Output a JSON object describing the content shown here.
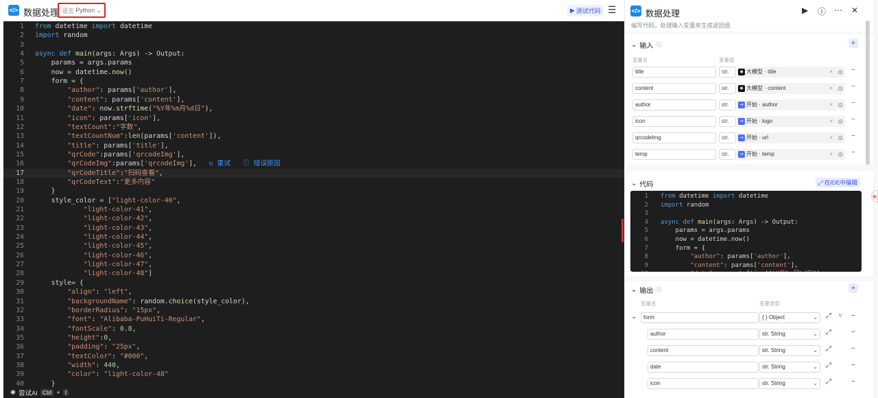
{
  "window": {
    "title": "数据处理",
    "language_label": "语言",
    "language": "Python",
    "test_button": "测试代码"
  },
  "editor": {
    "lines": [
      [
        {
          "t": "from",
          "c": "kw"
        },
        {
          "t": " datetime "
        },
        {
          "t": "import",
          "c": "kw"
        },
        {
          "t": " datetime"
        }
      ],
      [
        {
          "t": "import",
          "c": "kw"
        },
        {
          "t": " random"
        }
      ],
      [],
      [
        {
          "t": "async def",
          "c": "kw"
        },
        {
          "t": " "
        },
        {
          "t": "main",
          "c": "fn"
        },
        {
          "t": "(args: Args) -> Output:"
        }
      ],
      [
        {
          "t": "    params = args.params"
        }
      ],
      [
        {
          "t": "    now = datetime."
        },
        {
          "t": "now",
          "c": "fn"
        },
        {
          "t": "()"
        }
      ],
      [
        {
          "t": "    form = {"
        }
      ],
      [
        {
          "t": "        "
        },
        {
          "t": "\"author\"",
          "c": "str"
        },
        {
          "t": ": params["
        },
        {
          "t": "'author'",
          "c": "str"
        },
        {
          "t": "],"
        }
      ],
      [
        {
          "t": "        "
        },
        {
          "t": "\"content\"",
          "c": "str"
        },
        {
          "t": ": params["
        },
        {
          "t": "'content'",
          "c": "str"
        },
        {
          "t": "],"
        }
      ],
      [
        {
          "t": "        "
        },
        {
          "t": "\"date\"",
          "c": "str"
        },
        {
          "t": ": now."
        },
        {
          "t": "strftime",
          "c": "fn"
        },
        {
          "t": "("
        },
        {
          "t": "\"%Y年%m月%d日\"",
          "c": "str"
        },
        {
          "t": "),"
        }
      ],
      [
        {
          "t": "        "
        },
        {
          "t": "\"icon\"",
          "c": "str"
        },
        {
          "t": ": params["
        },
        {
          "t": "'icon'",
          "c": "str"
        },
        {
          "t": "],"
        }
      ],
      [
        {
          "t": "        "
        },
        {
          "t": "\"textCount\"",
          "c": "str"
        },
        {
          "t": ":"
        },
        {
          "t": "\"字数\"",
          "c": "str"
        },
        {
          "t": ","
        }
      ],
      [
        {
          "t": "        "
        },
        {
          "t": "\"textCountNum\"",
          "c": "str"
        },
        {
          "t": ":"
        },
        {
          "t": "len",
          "c": "fn"
        },
        {
          "t": "(params["
        },
        {
          "t": "'content'",
          "c": "str"
        },
        {
          "t": "]),"
        }
      ],
      [
        {
          "t": "        "
        },
        {
          "t": "\"title\"",
          "c": "str"
        },
        {
          "t": ": params["
        },
        {
          "t": "'title'",
          "c": "str"
        },
        {
          "t": "],"
        }
      ],
      [
        {
          "t": "        "
        },
        {
          "t": "\"qrCode\"",
          "c": "str"
        },
        {
          "t": ":params["
        },
        {
          "t": "'qrcodeImg'",
          "c": "str"
        },
        {
          "t": "],"
        }
      ],
      [
        {
          "t": "        "
        },
        {
          "t": "\"qrCodeImg\"",
          "c": "str"
        },
        {
          "t": ":params["
        },
        {
          "t": "'qrcodeImg'",
          "c": "str"
        },
        {
          "t": "],   "
        },
        {
          "t": "↻ 重试",
          "c": "lnk"
        },
        {
          "t": "   "
        },
        {
          "t": "ⓘ 错误原因",
          "c": "err"
        }
      ],
      [
        {
          "t": "        "
        },
        {
          "t": "\"qrCodeTitle\"",
          "c": "str"
        },
        {
          "t": ":"
        },
        {
          "t": "\"扫码查看\"",
          "c": "str"
        },
        {
          "t": ","
        }
      ],
      [
        {
          "t": "        "
        },
        {
          "t": "\"qrCodeText\"",
          "c": "str"
        },
        {
          "t": ":"
        },
        {
          "t": "\"更多内容\"",
          "c": "str"
        }
      ],
      [
        {
          "t": "    }"
        }
      ],
      [
        {
          "t": "    style_color = ["
        },
        {
          "t": "\"light-color-40\"",
          "c": "str"
        },
        {
          "t": ","
        }
      ],
      [
        {
          "t": "            "
        },
        {
          "t": "\"light-color-41\"",
          "c": "str"
        },
        {
          "t": ","
        }
      ],
      [
        {
          "t": "            "
        },
        {
          "t": "\"light-color-42\"",
          "c": "str"
        },
        {
          "t": ","
        }
      ],
      [
        {
          "t": "            "
        },
        {
          "t": "\"light-color-43\"",
          "c": "str"
        },
        {
          "t": ","
        }
      ],
      [
        {
          "t": "            "
        },
        {
          "t": "\"light-color-44\"",
          "c": "str"
        },
        {
          "t": ","
        }
      ],
      [
        {
          "t": "            "
        },
        {
          "t": "\"light-color-45\"",
          "c": "str"
        },
        {
          "t": ","
        }
      ],
      [
        {
          "t": "            "
        },
        {
          "t": "\"light-color-46\"",
          "c": "str"
        },
        {
          "t": ","
        }
      ],
      [
        {
          "t": "            "
        },
        {
          "t": "\"light-color-47\"",
          "c": "str"
        },
        {
          "t": ","
        }
      ],
      [
        {
          "t": "            "
        },
        {
          "t": "\"light-color-48\"",
          "c": "str"
        },
        {
          "t": "]"
        }
      ],
      [
        {
          "t": "    style= {"
        }
      ],
      [
        {
          "t": "        "
        },
        {
          "t": "\"align\"",
          "c": "str"
        },
        {
          "t": ": "
        },
        {
          "t": "\"left\"",
          "c": "str"
        },
        {
          "t": ","
        }
      ],
      [
        {
          "t": "        "
        },
        {
          "t": "\"backgroundName\"",
          "c": "str"
        },
        {
          "t": ": random."
        },
        {
          "t": "choice",
          "c": "fn"
        },
        {
          "t": "(style_color),"
        }
      ],
      [
        {
          "t": "        "
        },
        {
          "t": "\"borderRadius\"",
          "c": "str"
        },
        {
          "t": ": "
        },
        {
          "t": "\"15px\"",
          "c": "str"
        },
        {
          "t": ","
        }
      ],
      [
        {
          "t": "        "
        },
        {
          "t": "\"font\"",
          "c": "str"
        },
        {
          "t": ": "
        },
        {
          "t": "\"Alibaba-PuHuiTi-Regular\"",
          "c": "str"
        },
        {
          "t": ","
        }
      ],
      [
        {
          "t": "        "
        },
        {
          "t": "\"fontScale\"",
          "c": "str"
        },
        {
          "t": ": "
        },
        {
          "t": "0.8",
          "c": "num"
        },
        {
          "t": ","
        }
      ],
      [
        {
          "t": "        "
        },
        {
          "t": "\"height\"",
          "c": "str"
        },
        {
          "t": ":"
        },
        {
          "t": "0",
          "c": "num"
        },
        {
          "t": ","
        }
      ],
      [
        {
          "t": "        "
        },
        {
          "t": "\"padding\"",
          "c": "str"
        },
        {
          "t": ": "
        },
        {
          "t": "\"25px\"",
          "c": "str"
        },
        {
          "t": ","
        }
      ],
      [
        {
          "t": "        "
        },
        {
          "t": "\"textColor\"",
          "c": "str"
        },
        {
          "t": ": "
        },
        {
          "t": "\"#000\"",
          "c": "str"
        },
        {
          "t": ","
        }
      ],
      [
        {
          "t": "        "
        },
        {
          "t": "\"width\"",
          "c": "str"
        },
        {
          "t": ": "
        },
        {
          "t": "440",
          "c": "num"
        },
        {
          "t": ","
        }
      ],
      [
        {
          "t": "        "
        },
        {
          "t": "\"color\"",
          "c": "str"
        },
        {
          "t": ": "
        },
        {
          "t": "\"light-color-48\"",
          "c": "str"
        }
      ],
      [
        {
          "t": "    }"
        }
      ]
    ],
    "active_line": 17,
    "bottom": {
      "ai_label": "尝试AI",
      "key1": "Ctrl",
      "plus": "+",
      "key2": "I"
    }
  },
  "node": {
    "title": "数据处理",
    "description": "编写代码，处理输入变量来生成返回值",
    "input": {
      "title": "输入",
      "col_name": "变量名",
      "col_value": "变量值",
      "rows": [
        {
          "name": "title",
          "type": "str.",
          "ref_icon": "model",
          "ref": "大模型 · title"
        },
        {
          "name": "content",
          "type": "str.",
          "ref_icon": "model",
          "ref": "大模型 · content"
        },
        {
          "name": "author",
          "type": "str.",
          "ref_icon": "start",
          "ref": "开始 · author"
        },
        {
          "name": "icon",
          "type": "str.",
          "ref_icon": "start",
          "ref": "开始 · logo"
        },
        {
          "name": "qrcodeImg",
          "type": "str.",
          "ref_icon": "start",
          "ref": "开始 · url"
        },
        {
          "name": "temp",
          "type": "str.",
          "ref_icon": "start",
          "ref": "开始 · temp"
        }
      ]
    },
    "code": {
      "title": "代码",
      "ide_button": "在IDE中编辑",
      "lines": [
        [
          {
            "t": "from",
            "c": "kw"
          },
          {
            "t": " datetime "
          },
          {
            "t": "import",
            "c": "kw"
          },
          {
            "t": " datetime"
          }
        ],
        [
          {
            "t": "import",
            "c": "kw"
          },
          {
            "t": " random"
          }
        ],
        [],
        [
          {
            "t": "async def",
            "c": "kw"
          },
          {
            "t": " "
          },
          {
            "t": "main",
            "c": "fn"
          },
          {
            "t": "(args: Args) -> Output:"
          }
        ],
        [
          {
            "t": "    params = args.params"
          }
        ],
        [
          {
            "t": "    now = datetime."
          },
          {
            "t": "now",
            "c": "fn"
          },
          {
            "t": "()"
          }
        ],
        [
          {
            "t": "    form = {"
          }
        ],
        [
          {
            "t": "        "
          },
          {
            "t": "\"author\"",
            "c": "str"
          },
          {
            "t": ": params["
          },
          {
            "t": "'author'",
            "c": "str"
          },
          {
            "t": "],"
          }
        ],
        [
          {
            "t": "        "
          },
          {
            "t": "\"content\"",
            "c": "str"
          },
          {
            "t": ": params["
          },
          {
            "t": "'content'",
            "c": "str"
          },
          {
            "t": "],"
          }
        ],
        [
          {
            "t": "        "
          },
          {
            "t": "\"date\"",
            "c": "str"
          },
          {
            "t": ": now."
          },
          {
            "t": "strftime",
            "c": "fn"
          },
          {
            "t": "("
          },
          {
            "t": "\"%Y年%m月%d日\"",
            "c": "str"
          },
          {
            "t": "),"
          }
        ]
      ]
    },
    "output": {
      "title": "输出",
      "col_name": "变量名",
      "col_type": "变量类型",
      "rows": [
        {
          "name": "form",
          "type": "{ } Object",
          "level": 0
        },
        {
          "name": "author",
          "type": "str. String",
          "level": 1
        },
        {
          "name": "content",
          "type": "str. String",
          "level": 1
        },
        {
          "name": "date",
          "type": "str. String",
          "level": 1
        },
        {
          "name": "icon",
          "type": "str. String",
          "level": 1
        }
      ]
    }
  },
  "colors": {
    "accent": "#3b55e6",
    "highlight_border": "#e02020",
    "editor_bg": "#1e1e1e"
  }
}
